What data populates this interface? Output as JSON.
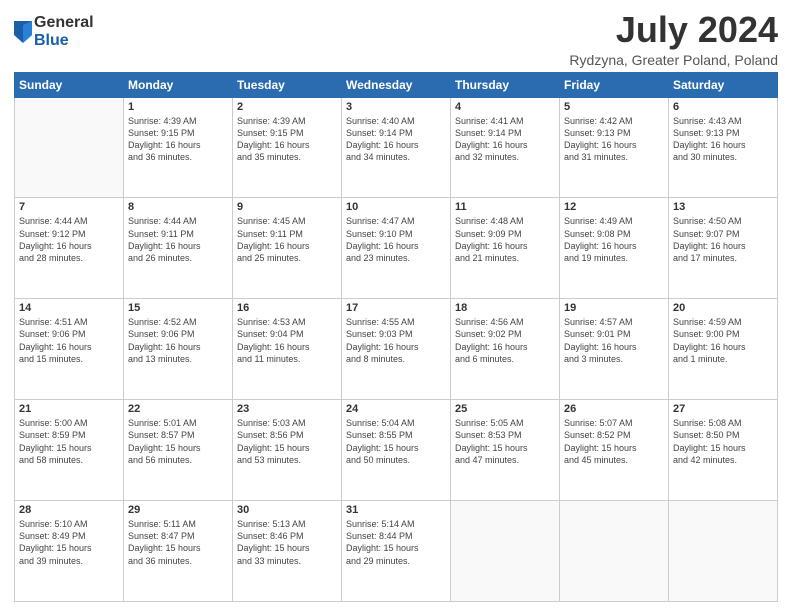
{
  "header": {
    "logo_general": "General",
    "logo_blue": "Blue",
    "month_year": "July 2024",
    "location": "Rydzyna, Greater Poland, Poland"
  },
  "weekdays": [
    "Sunday",
    "Monday",
    "Tuesday",
    "Wednesday",
    "Thursday",
    "Friday",
    "Saturday"
  ],
  "weeks": [
    [
      {
        "day": "",
        "detail": ""
      },
      {
        "day": "1",
        "detail": "Sunrise: 4:39 AM\nSunset: 9:15 PM\nDaylight: 16 hours\nand 36 minutes."
      },
      {
        "day": "2",
        "detail": "Sunrise: 4:39 AM\nSunset: 9:15 PM\nDaylight: 16 hours\nand 35 minutes."
      },
      {
        "day": "3",
        "detail": "Sunrise: 4:40 AM\nSunset: 9:14 PM\nDaylight: 16 hours\nand 34 minutes."
      },
      {
        "day": "4",
        "detail": "Sunrise: 4:41 AM\nSunset: 9:14 PM\nDaylight: 16 hours\nand 32 minutes."
      },
      {
        "day": "5",
        "detail": "Sunrise: 4:42 AM\nSunset: 9:13 PM\nDaylight: 16 hours\nand 31 minutes."
      },
      {
        "day": "6",
        "detail": "Sunrise: 4:43 AM\nSunset: 9:13 PM\nDaylight: 16 hours\nand 30 minutes."
      }
    ],
    [
      {
        "day": "7",
        "detail": "Sunrise: 4:44 AM\nSunset: 9:12 PM\nDaylight: 16 hours\nand 28 minutes."
      },
      {
        "day": "8",
        "detail": "Sunrise: 4:44 AM\nSunset: 9:11 PM\nDaylight: 16 hours\nand 26 minutes."
      },
      {
        "day": "9",
        "detail": "Sunrise: 4:45 AM\nSunset: 9:11 PM\nDaylight: 16 hours\nand 25 minutes."
      },
      {
        "day": "10",
        "detail": "Sunrise: 4:47 AM\nSunset: 9:10 PM\nDaylight: 16 hours\nand 23 minutes."
      },
      {
        "day": "11",
        "detail": "Sunrise: 4:48 AM\nSunset: 9:09 PM\nDaylight: 16 hours\nand 21 minutes."
      },
      {
        "day": "12",
        "detail": "Sunrise: 4:49 AM\nSunset: 9:08 PM\nDaylight: 16 hours\nand 19 minutes."
      },
      {
        "day": "13",
        "detail": "Sunrise: 4:50 AM\nSunset: 9:07 PM\nDaylight: 16 hours\nand 17 minutes."
      }
    ],
    [
      {
        "day": "14",
        "detail": "Sunrise: 4:51 AM\nSunset: 9:06 PM\nDaylight: 16 hours\nand 15 minutes."
      },
      {
        "day": "15",
        "detail": "Sunrise: 4:52 AM\nSunset: 9:06 PM\nDaylight: 16 hours\nand 13 minutes."
      },
      {
        "day": "16",
        "detail": "Sunrise: 4:53 AM\nSunset: 9:04 PM\nDaylight: 16 hours\nand 11 minutes."
      },
      {
        "day": "17",
        "detail": "Sunrise: 4:55 AM\nSunset: 9:03 PM\nDaylight: 16 hours\nand 8 minutes."
      },
      {
        "day": "18",
        "detail": "Sunrise: 4:56 AM\nSunset: 9:02 PM\nDaylight: 16 hours\nand 6 minutes."
      },
      {
        "day": "19",
        "detail": "Sunrise: 4:57 AM\nSunset: 9:01 PM\nDaylight: 16 hours\nand 3 minutes."
      },
      {
        "day": "20",
        "detail": "Sunrise: 4:59 AM\nSunset: 9:00 PM\nDaylight: 16 hours\nand 1 minute."
      }
    ],
    [
      {
        "day": "21",
        "detail": "Sunrise: 5:00 AM\nSunset: 8:59 PM\nDaylight: 15 hours\nand 58 minutes."
      },
      {
        "day": "22",
        "detail": "Sunrise: 5:01 AM\nSunset: 8:57 PM\nDaylight: 15 hours\nand 56 minutes."
      },
      {
        "day": "23",
        "detail": "Sunrise: 5:03 AM\nSunset: 8:56 PM\nDaylight: 15 hours\nand 53 minutes."
      },
      {
        "day": "24",
        "detail": "Sunrise: 5:04 AM\nSunset: 8:55 PM\nDaylight: 15 hours\nand 50 minutes."
      },
      {
        "day": "25",
        "detail": "Sunrise: 5:05 AM\nSunset: 8:53 PM\nDaylight: 15 hours\nand 47 minutes."
      },
      {
        "day": "26",
        "detail": "Sunrise: 5:07 AM\nSunset: 8:52 PM\nDaylight: 15 hours\nand 45 minutes."
      },
      {
        "day": "27",
        "detail": "Sunrise: 5:08 AM\nSunset: 8:50 PM\nDaylight: 15 hours\nand 42 minutes."
      }
    ],
    [
      {
        "day": "28",
        "detail": "Sunrise: 5:10 AM\nSunset: 8:49 PM\nDaylight: 15 hours\nand 39 minutes."
      },
      {
        "day": "29",
        "detail": "Sunrise: 5:11 AM\nSunset: 8:47 PM\nDaylight: 15 hours\nand 36 minutes."
      },
      {
        "day": "30",
        "detail": "Sunrise: 5:13 AM\nSunset: 8:46 PM\nDaylight: 15 hours\nand 33 minutes."
      },
      {
        "day": "31",
        "detail": "Sunrise: 5:14 AM\nSunset: 8:44 PM\nDaylight: 15 hours\nand 29 minutes."
      },
      {
        "day": "",
        "detail": ""
      },
      {
        "day": "",
        "detail": ""
      },
      {
        "day": "",
        "detail": ""
      }
    ]
  ]
}
